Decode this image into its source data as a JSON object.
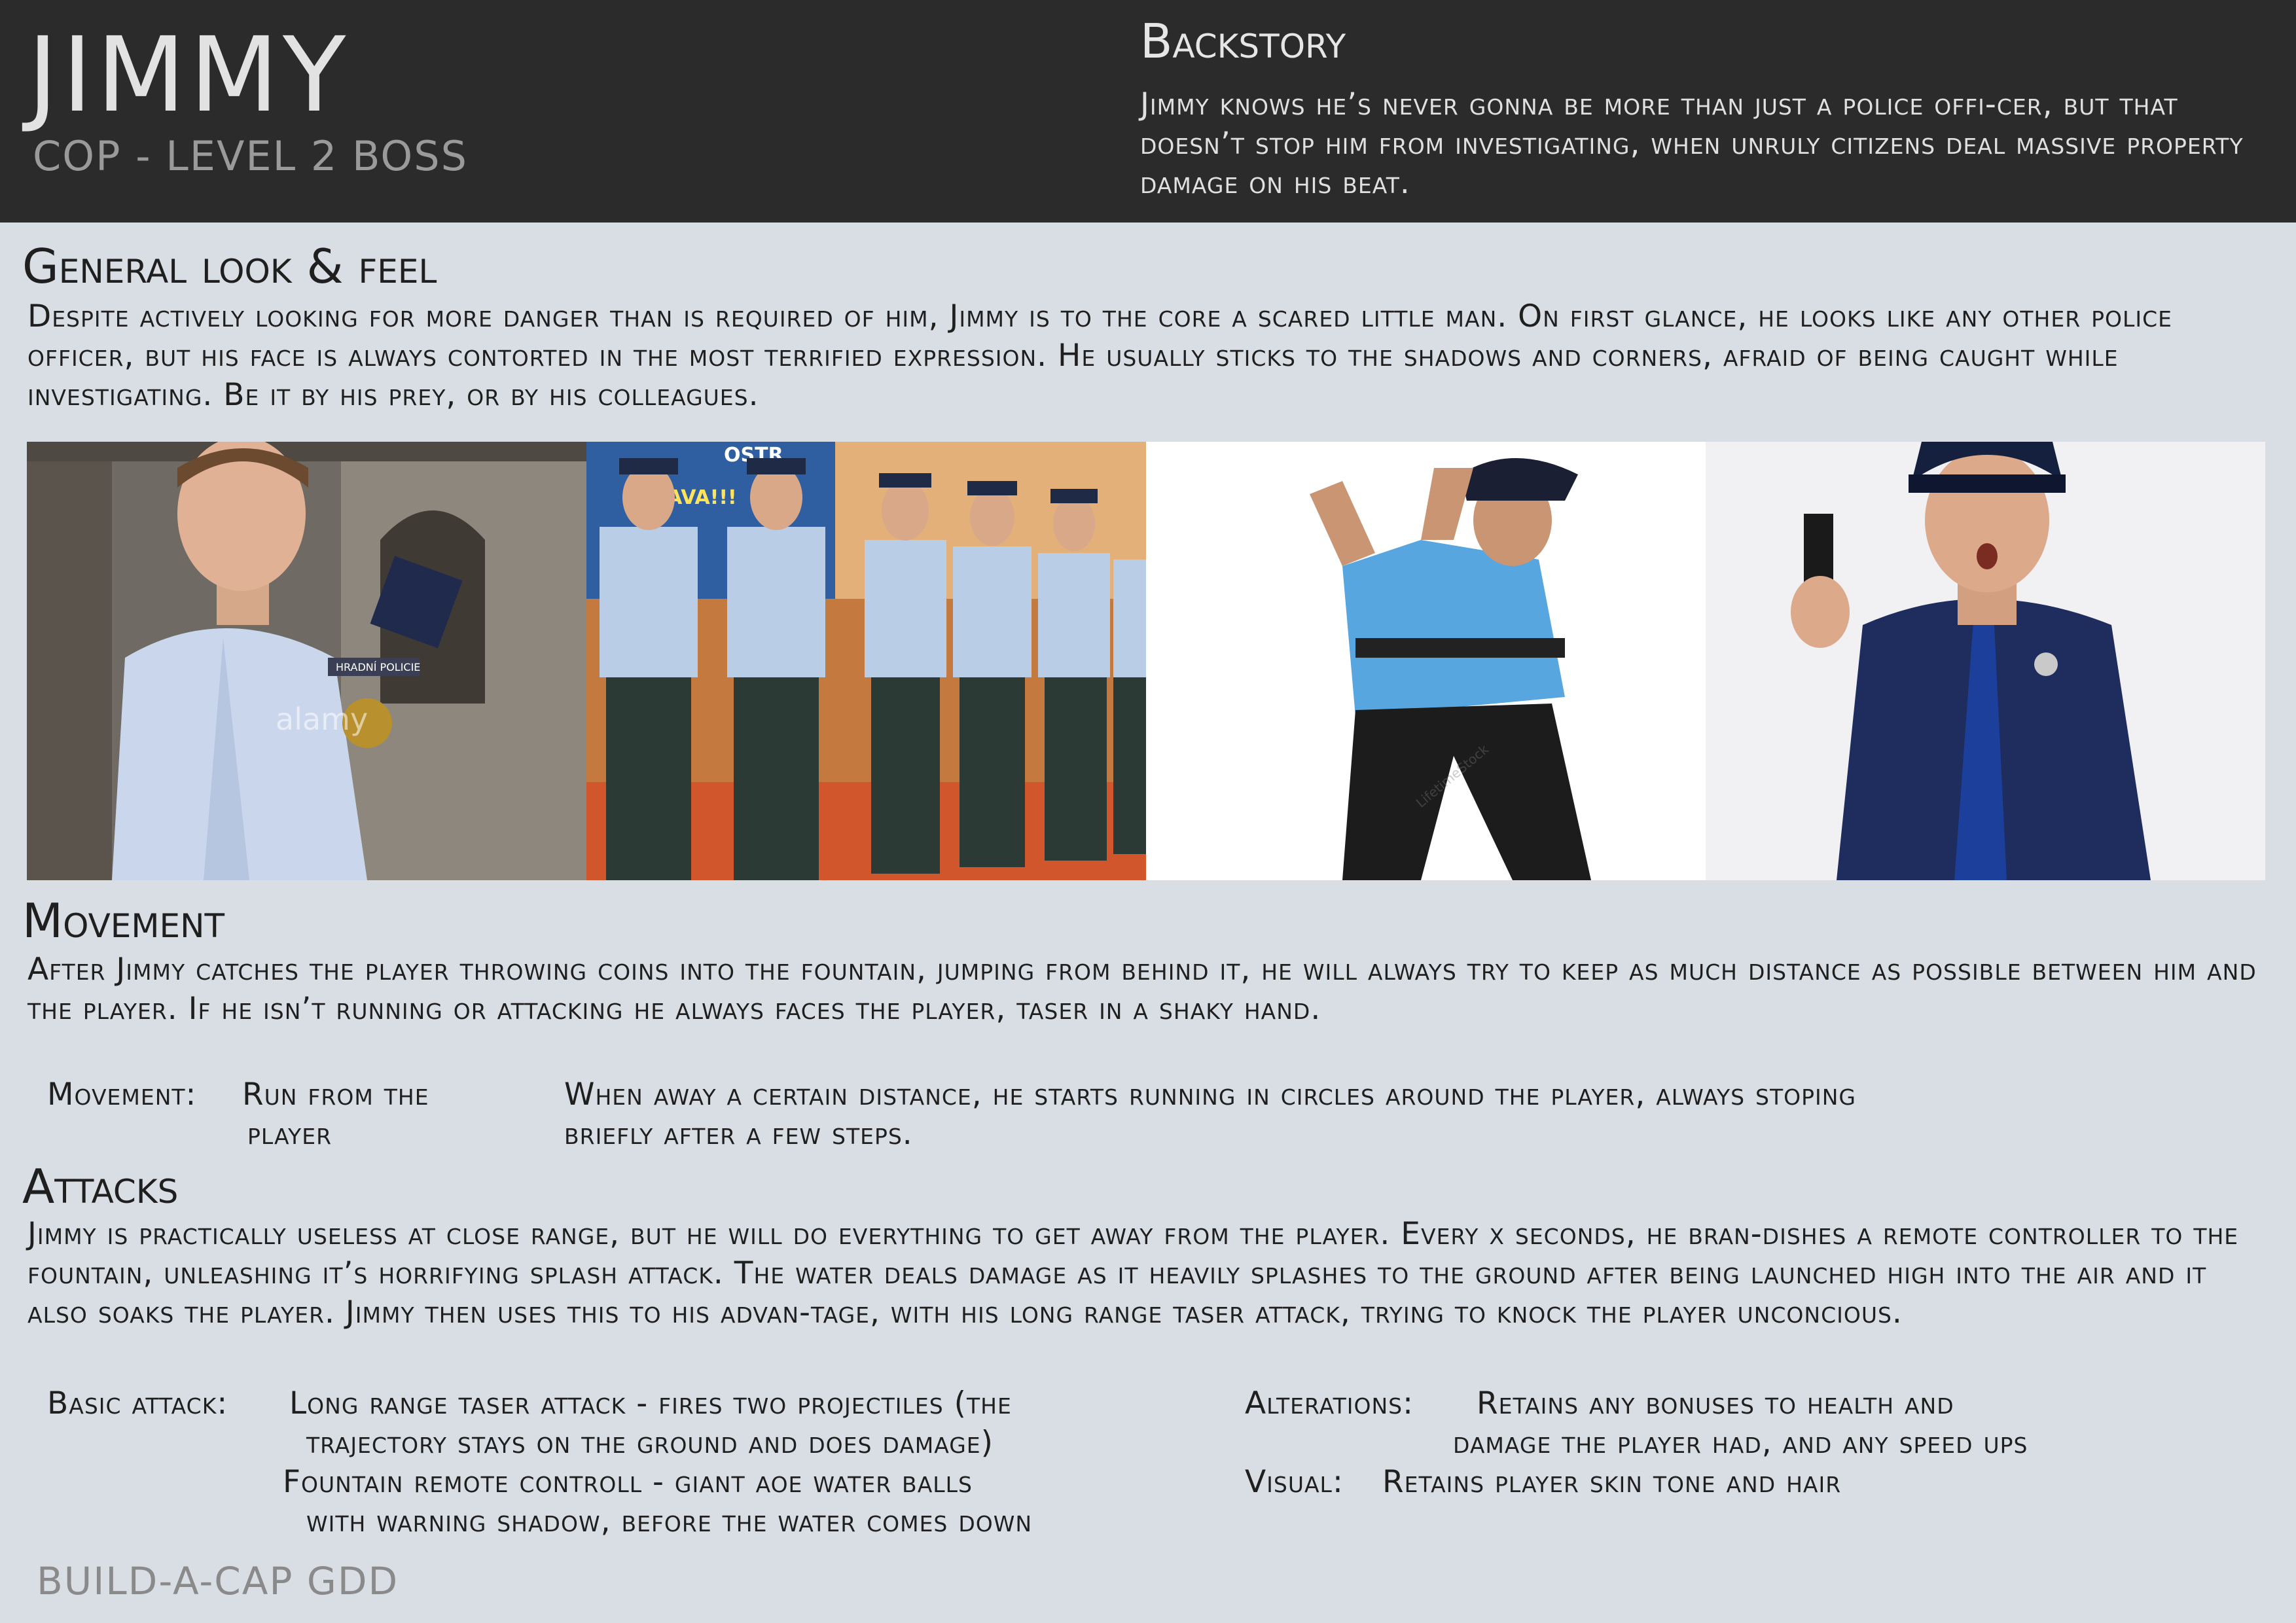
{
  "header": {
    "name": "JIMMY",
    "role": "COP - LEVEL 2 BOSS",
    "backstory_title": "Backstory",
    "backstory_text": "Jimmy knows he’s never gonna be more than just a police offi-cer, but that doesn’t stop him from investigating, when unruly citizens deal massive property damage on his beat."
  },
  "look": {
    "title": "General look & feel",
    "text": "Despite actively looking for more danger than is required of him, Jimmy is to the core a scared little man. On first glance, he looks like any other police officer, but his face is always contorted in the most terrified expression. He usually sticks to the shadows and corners, afraid of being caught while investigating. Be it by his prey, or by his colleagues."
  },
  "photos": {
    "p1_badge": "HRADNÍ POLICIE",
    "p1_watermark": "alamy",
    "p2_sign": "OSTR",
    "p2_sign2": "RAVA!!!",
    "p3_watermark": "LifetimeStock"
  },
  "movement": {
    "title": "Movement",
    "text": "After Jimmy catches the player throwing coins into the fountain, jumping from behind it, he will always try to keep as much distance as possible between him and the player. If he isn’t running or attacking he always faces the player, taser in a shaky hand.",
    "label": "Movement:",
    "value_line1": "Run from the",
    "value_line2": "player",
    "detail_line1": "When away a certain distance, he starts running in circles around the player, always stoping",
    "detail_line2": "briefly after a few steps."
  },
  "attacks": {
    "title": "Attacks",
    "text": "Jimmy is practically useless at close range, but he will do everything to get away from the player. Every x seconds, he bran-dishes a remote controller to the fountain, unleashing it’s horrifying splash attack. The water deals damage as it heavily splashes to the ground after being launched high into the air and it also soaks the player. Jimmy then uses this to his advan-tage, with his long range taser attack, trying to knock the player unconcious.",
    "basic_label": "Basic attack:",
    "basic_line1": "Long range taser attack - fires two projectiles (the",
    "basic_line2": "trajectory stays on the ground and does damage)",
    "fountain_line1": "Fountain remote controll - giant aoe water balls",
    "fountain_line2": "with warning shadow, before the water comes down",
    "alterations_label": "Alterations:",
    "alterations_line1": "Retains any bonuses to health and",
    "alterations_line2": "damage the player had, and any speed ups",
    "visual_label": "Visual:",
    "visual_value": "Retains player skin tone and hair"
  },
  "footer": {
    "text": "BUILD-A-CAP GDD"
  }
}
